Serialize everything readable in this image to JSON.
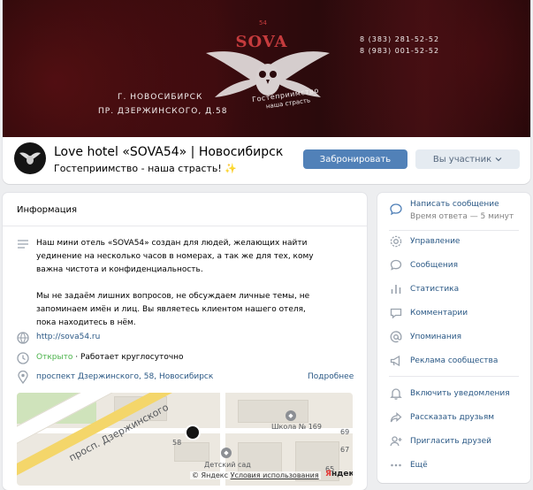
{
  "colors": {
    "accent": "#5181b8",
    "link": "#2a5885",
    "open": "#4bb34b",
    "cover_red": "#c63b3d"
  },
  "cover": {
    "brand": "SOVA",
    "badge": "54",
    "motto_line1": "Гостеприимство",
    "motto_line2": "наша страсть",
    "city": "Г. НОВОСИБИРСК",
    "address": "ПР. ДЗЕРЖИНСКОГО, Д.58",
    "phone1": "8 (383) 281-52-52",
    "phone2": "8 (983) 001-52-52"
  },
  "header": {
    "name": "Love hotel «SOVA54» | Новосибирск",
    "status": "Гостеприимство - наша страсть!",
    "status_emoji": "✨",
    "book_button": "Забронировать",
    "member_button": "Вы участник"
  },
  "info": {
    "title": "Информация",
    "description_p1": "Наш мини отель «SOVA54» создан для людей, желающих найти уединение на несколько часов в номерах, а так же для тех, кому важна чистота и конфиденциальность.",
    "description_p2": "Мы не задаём лишних вопросов, не обсуждаем личные темы, не запоминаем имён и лиц. Вы являетесь клиентом нашего отеля, пока находитесь в нём.",
    "website": "http://sova54.ru",
    "open_label": "Открыто",
    "hours_sep": " · ",
    "hours": "Работает круглосуточно",
    "address": "проспект Дзержинского, 58, Новосибирск",
    "more_link": "Подробнее"
  },
  "map": {
    "street": "просп. Дзержинского",
    "house_58": "58",
    "school": "Школа № 169",
    "kindergarten": "Детский сад",
    "num_69": "69",
    "num_67": "67",
    "num_65": "65",
    "copyright": "© Яндекс",
    "terms": "Условия использования",
    "logo_letter": "Я",
    "logo_rest": "ндекс"
  },
  "side_menu": {
    "message": "Написать сообщение",
    "response_time": "Время ответа — 5 минут",
    "items": [
      {
        "label": "Управление",
        "icon": "gear-icon"
      },
      {
        "label": "Сообщения",
        "icon": "chat-bubble-icon"
      },
      {
        "label": "Статистика",
        "icon": "bar-chart-icon"
      },
      {
        "label": "Комментарии",
        "icon": "comment-icon"
      },
      {
        "label": "Упоминания",
        "icon": "at-sign-icon"
      },
      {
        "label": "Реклама сообщества",
        "icon": "megaphone-icon"
      }
    ],
    "items2": [
      {
        "label": "Включить уведомления",
        "icon": "bell-icon"
      },
      {
        "label": "Рассказать друзьям",
        "icon": "share-icon"
      },
      {
        "label": "Пригласить друзей",
        "icon": "add-user-icon"
      },
      {
        "label": "Ещё",
        "icon": "more-dots-icon"
      }
    ]
  }
}
